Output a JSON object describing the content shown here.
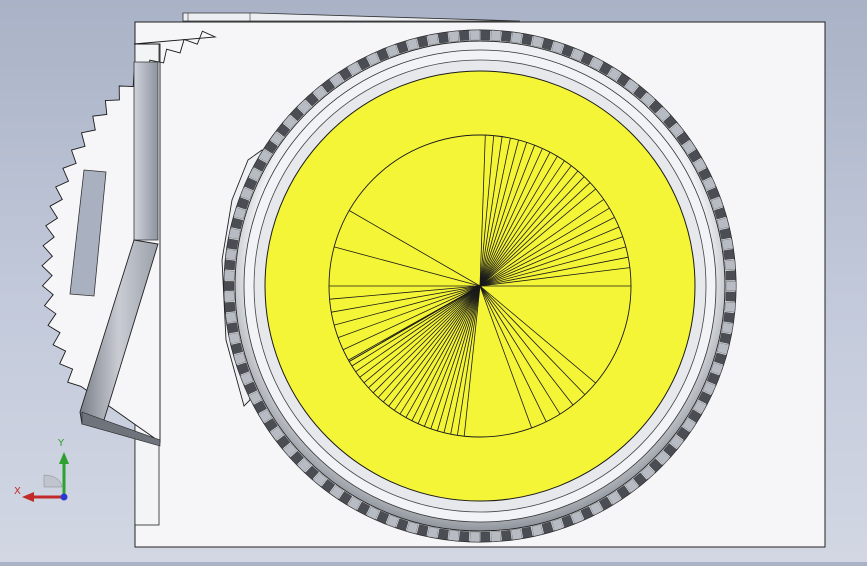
{
  "view": {
    "background_top": "#a9b2c6",
    "background_bottom": "#d2d7e3",
    "part_face_color": "#f6f6f8",
    "highlight_color": "#f5f537",
    "edge_color": "#1a1a1a"
  },
  "triad": {
    "x_label": "X",
    "y_label": "Y",
    "x_color": "#c22a2a",
    "y_color": "#2da02d",
    "z_color": "#2a3ad0"
  }
}
